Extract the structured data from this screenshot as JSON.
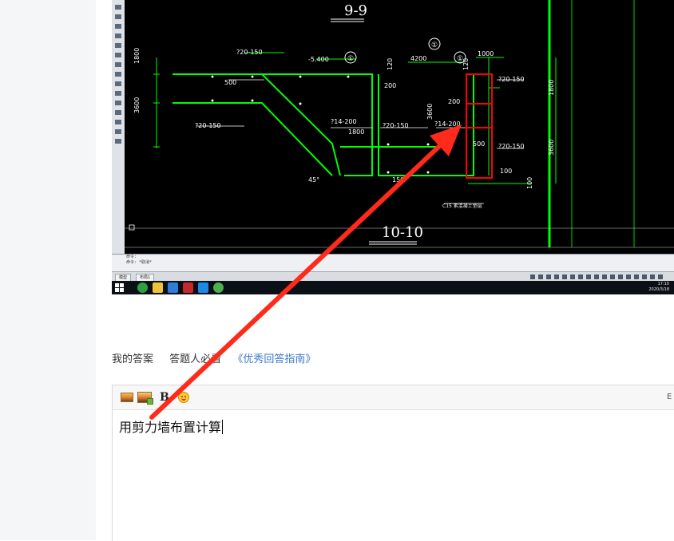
{
  "cad": {
    "section_top": "9-9",
    "section_bottom": "10-10",
    "dims": {
      "d_5400": "-5.400",
      "d_4200": "4200",
      "d_1000": "1000",
      "d_1800_left": "1800",
      "d_3600_left": "3600",
      "d_500_a": "500",
      "d_500_b": "500",
      "d_1800_mid": "1800",
      "d_3600_mid": "3600",
      "d_1800_right": "1800",
      "d_3600_right": "3600",
      "d_200_a": "200",
      "d_200_b": "200",
      "d_120_a": "120",
      "d_120_b": "120",
      "d_100_a": "100",
      "d_100_b": "100",
      "d_150": "150",
      "d_45": "45°"
    },
    "rebar": {
      "r1": "?20-150",
      "r2": "?20-150",
      "r3": "?14-200",
      "r4": "?20-150",
      "r5": "?14-200",
      "r6": "?20-150",
      "r7": "?20-150"
    },
    "concrete_note": "C15 素混凝土垫层",
    "circle_1": "①",
    "circle_2": "①",
    "circle_3": "①",
    "cmd_line_1": "命令:",
    "cmd_line_2": "命令: *取消*",
    "tabs": [
      "模型",
      "布局1"
    ],
    "clock_time": "17:10",
    "clock_date": "2020/3/18"
  },
  "answer": {
    "my_answer": "我的答案",
    "must_read": "答题人必看",
    "guide_link": "《优秀回答指南》"
  },
  "editor": {
    "content": "用剪力墙布置计算",
    "corner_label": "E"
  },
  "colors": {
    "cad_background": "#000000",
    "cad_green": "#00ff00",
    "cad_red": "#ff0000",
    "annotation_arrow": "#ff2a1a",
    "link_blue": "#3a78c3"
  }
}
